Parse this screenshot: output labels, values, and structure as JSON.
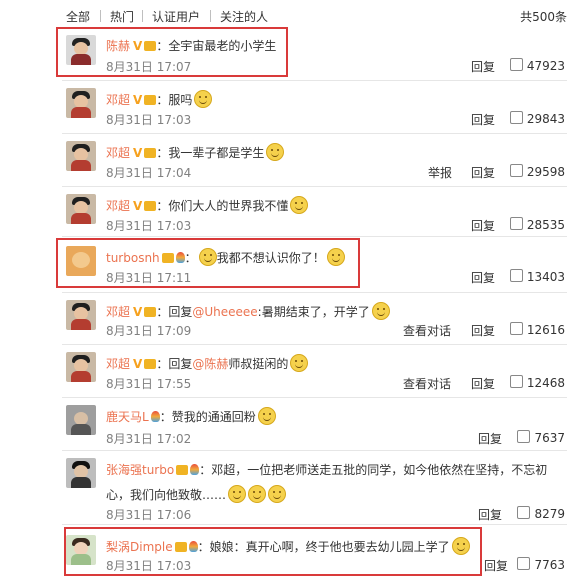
{
  "tabs": [
    "全部",
    "热门",
    "认证用户",
    "关注的人"
  ],
  "total": "共500条",
  "comments": [
    {
      "user": "陈赫",
      "text": "全宇宙最老的小学生",
      "time": "8月31日 17:07",
      "reply": "回复",
      "likes": "47923"
    },
    {
      "user": "邓超",
      "text": "服吗",
      "time": "8月31日 17:03",
      "reply": "回复",
      "likes": "29843"
    },
    {
      "user": "邓超",
      "text": "我一辈子都是学生",
      "time": "8月31日 17:04",
      "report": "举报",
      "reply": "回复",
      "likes": "29598"
    },
    {
      "user": "邓超",
      "text": "你们大人的世界我不懂",
      "time": "8月31日 17:03",
      "reply": "回复",
      "likes": "28535"
    },
    {
      "user": "turbosnh",
      "text": "我都不想认识你了！",
      "time": "8月31日 17:11",
      "reply": "回复",
      "likes": "13403"
    },
    {
      "user": "邓超",
      "text_prefix": "回复",
      "mention": "@Uheeeee",
      "text": ":暑期结束了，开学了",
      "time": "8月31日 17:09",
      "view_convo": "查看对话",
      "reply": "回复",
      "likes": "12616"
    },
    {
      "user": "邓超",
      "text_prefix": "回复",
      "mention": "@陈赫",
      "text": "师叔挺闲的",
      "time": "8月31日 17:55",
      "view_convo": "查看对话",
      "reply": "回复",
      "likes": "12468"
    },
    {
      "user": "鹿天马L",
      "text": "赞我的通通回粉",
      "time": "8月31日 17:02",
      "reply": "回复",
      "likes": "7637"
    },
    {
      "user": "张海强turbo",
      "text": "邓超，一位把老师送走五批的同学，如今他依然在坚持，不忘初",
      "text2": "心，我们向他致敬……",
      "time": "8月31日 17:06",
      "reply": "回复",
      "likes": "8279"
    },
    {
      "user": "梨涡Dimple",
      "text": "娘娘：真开心啊，终于他也要去幼儿园上学了",
      "time": "8月31日 17:03",
      "reply": "回复",
      "likes": "7763"
    }
  ],
  "badges": {
    "verified": "V"
  },
  "colors": {
    "username": "#eb7350",
    "highlight_border": "#d93a3a",
    "date": "#808080"
  }
}
